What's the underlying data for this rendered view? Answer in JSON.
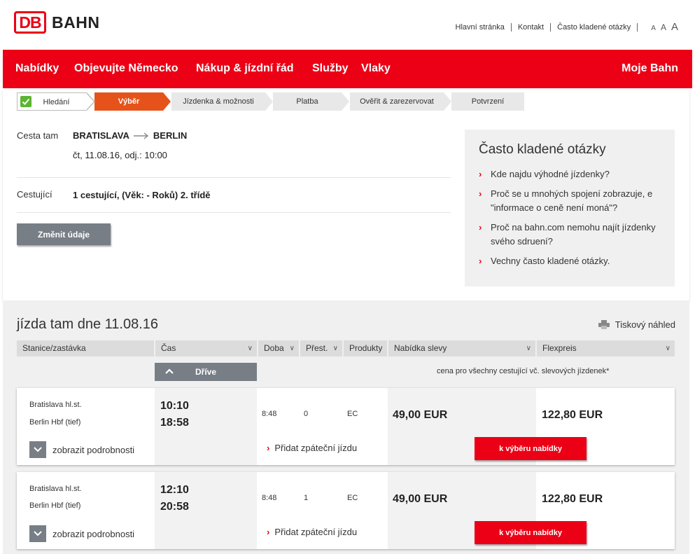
{
  "header": {
    "logo_db": "DB",
    "logo_bahn": "BAHN",
    "links": [
      "Hlavní stránka",
      "Kontakt",
      "Často kladené otázky"
    ],
    "font_sizes": [
      "A",
      "A",
      "A"
    ]
  },
  "nav": {
    "items": [
      "Nabídky",
      "Objevujte Německo",
      "Nákup & jízdní řád",
      "Služby",
      "Vlaky"
    ],
    "account": "Moje Bahn"
  },
  "steps": [
    "Hledání",
    "Výběr",
    "Jízdenka & možnosti",
    "Platba",
    "Ověřit & zarezervovat",
    "Potvrzení"
  ],
  "active_step": 1,
  "trip": {
    "outbound_label": "Cesta tam",
    "from": "BRATISLAVA",
    "to": "BERLIN",
    "datetime": "čt, 11.08.16, odj.: 10:00",
    "travellers_label": "Cestující",
    "travellers": "1 cestující, (Věk: - Roků) 2. třídě",
    "change_button": "Změnit údaje"
  },
  "faq": {
    "title": "Často kladené otázky",
    "items": [
      "Kde najdu výhodné jízdenky?",
      "Proč se u mnohých spojení zobrazuje, e \"informace o ceně není moná\"?",
      "Proč na bahn.com nemohu najít jízdenky svého sdruení?",
      "Vechny často kladené otázky."
    ]
  },
  "results": {
    "title": "jízda tam dne 11.08.16",
    "print_label": "Tiskový náhled",
    "columns": [
      "Stanice/zastávka",
      "Čas",
      "Doba",
      "Přest.",
      "Produkty",
      "Nabídka slevy",
      "Flexpreis"
    ],
    "earlier_button": "Dříve",
    "price_note": "cena pro všechny cestující vč. slevových jízdenek*",
    "details_label": "zobrazit podrobnosti",
    "return_label": "Přidat zpáteční jízdu",
    "offer_button": "k výběru nabídky",
    "connections": [
      {
        "from": "Bratislava hl.st.",
        "to": "Berlin Hbf (tief)",
        "dep": "10:10",
        "arr": "18:58",
        "duration": "8:48",
        "changes": "0",
        "product": "EC",
        "saver": "49,00 EUR",
        "flex": "122,80 EUR"
      },
      {
        "from": "Bratislava hl.st.",
        "to": "Berlin Hbf (tief)",
        "dep": "12:10",
        "arr": "20:58",
        "duration": "8:48",
        "changes": "1",
        "product": "EC",
        "saver": "49,00 EUR",
        "flex": "122,80 EUR"
      }
    ]
  },
  "colors": {
    "brand_red": "#ec0016",
    "step_active": "#e5531b",
    "button_gray": "#787e86"
  }
}
